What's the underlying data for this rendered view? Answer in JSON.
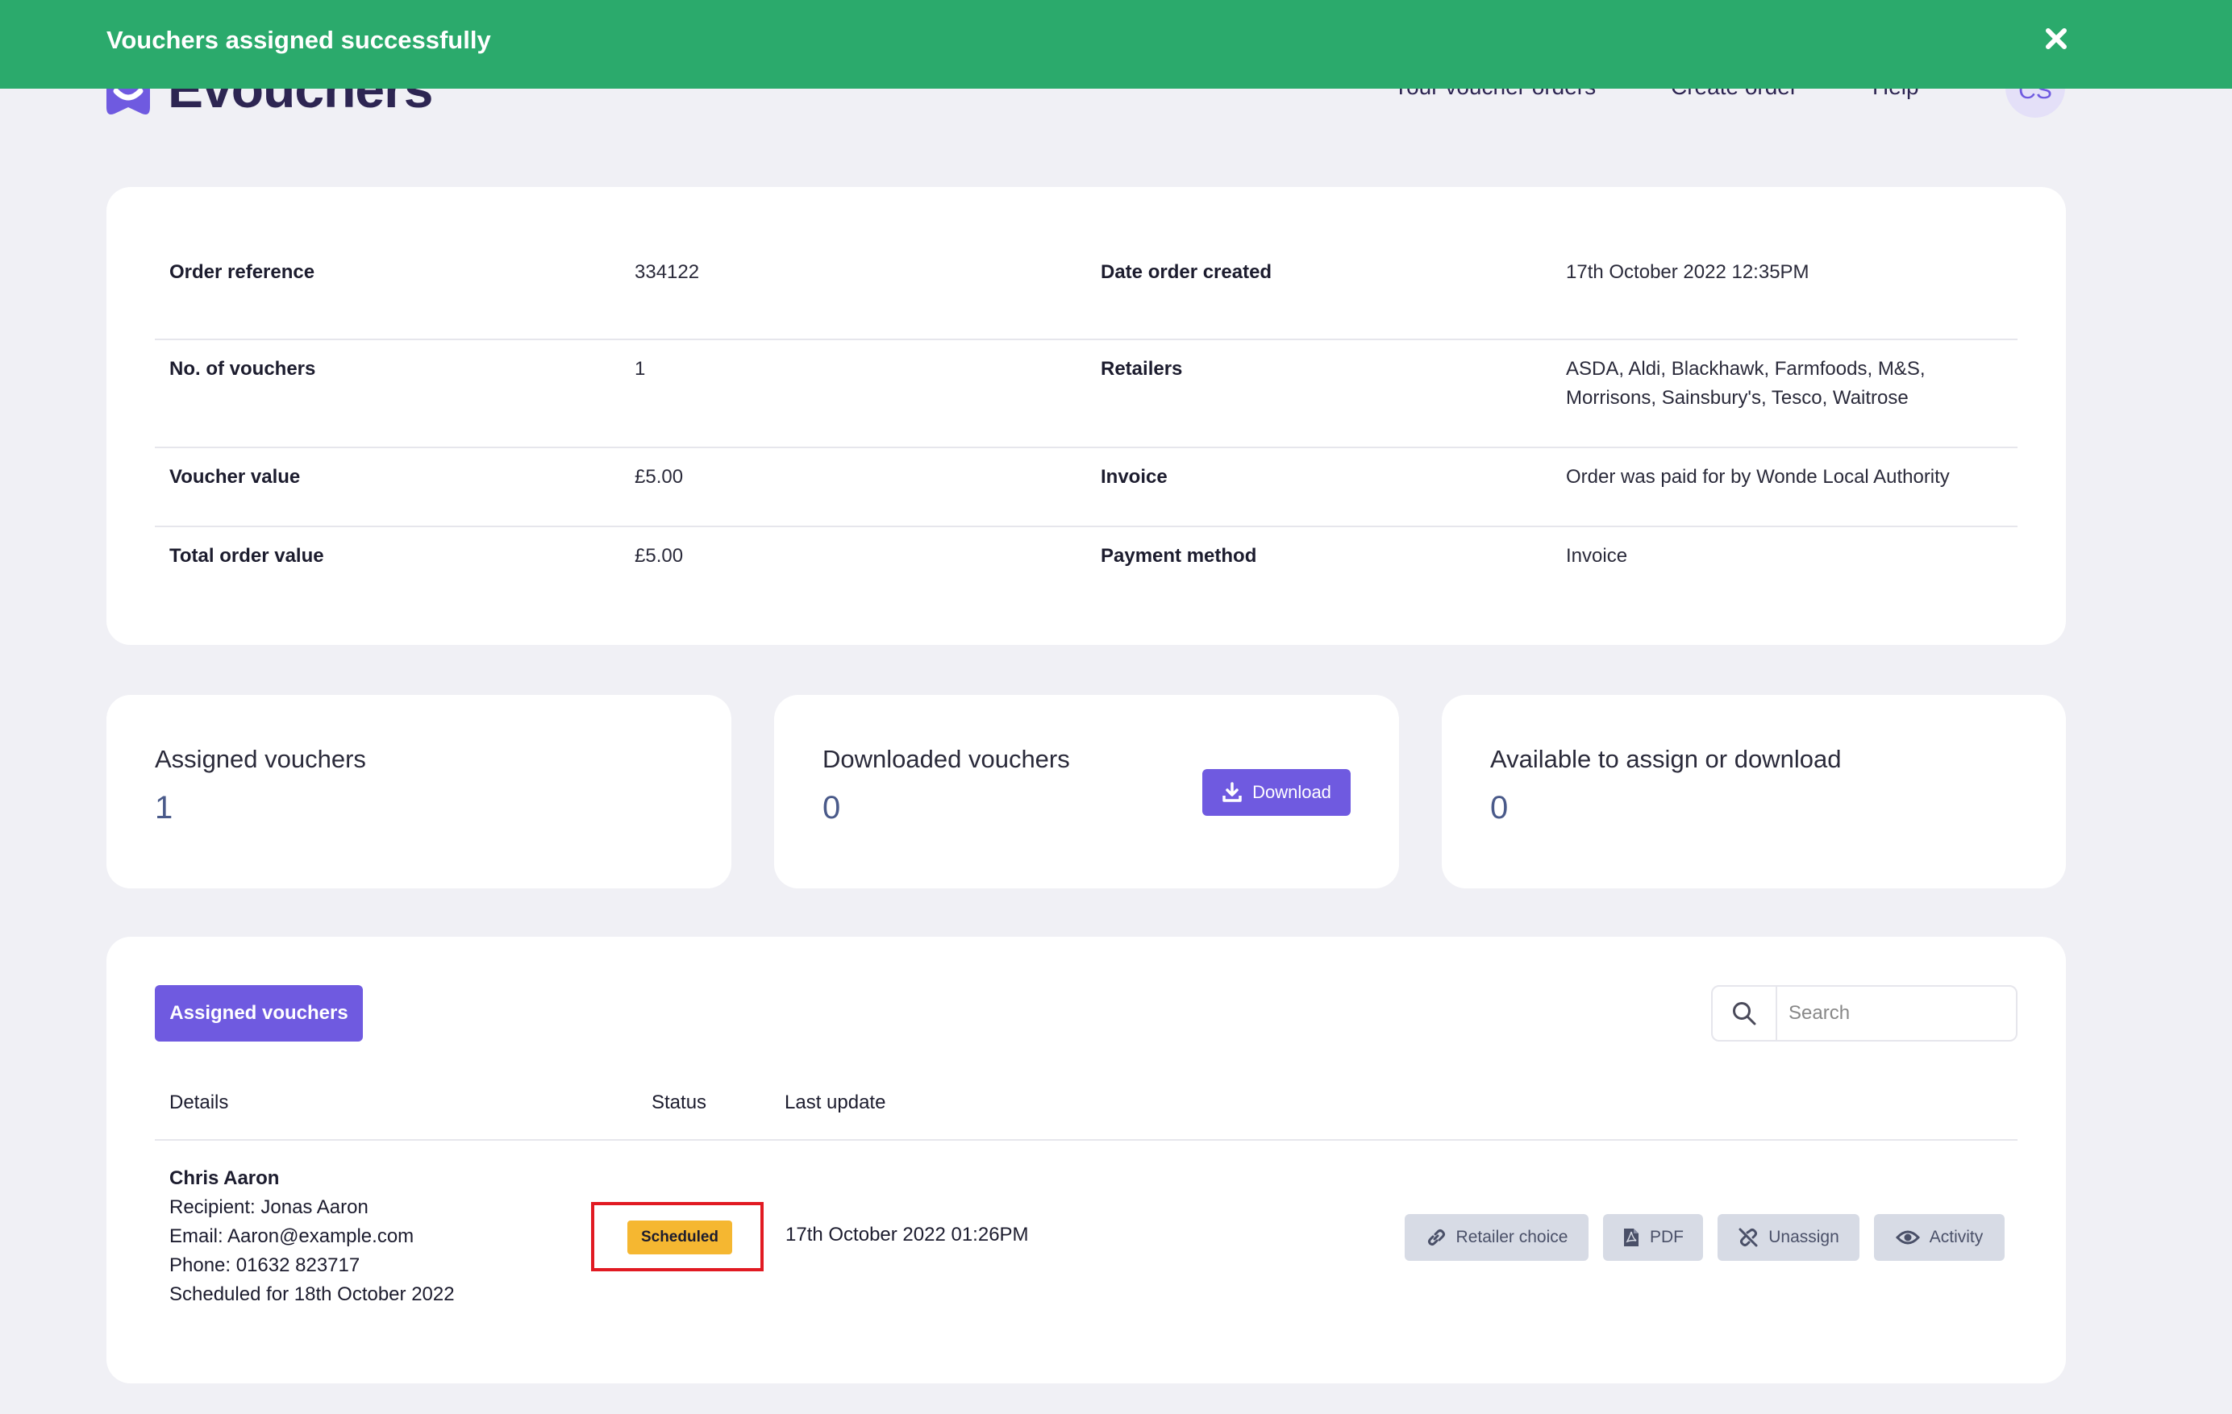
{
  "header": {
    "logo_text": "Evouchers",
    "nav": [
      "Your voucher orders",
      "Create order",
      "Help"
    ],
    "avatar_initials": "CS"
  },
  "toast": {
    "message": "Vouchers assigned successfully",
    "color": "#2baa6c",
    "close_icon": "close-icon"
  },
  "order_details": {
    "rows": [
      {
        "label1": "Order reference",
        "value1": "334122",
        "label2": "Date order created",
        "value2": "17th October 2022 12:35PM"
      },
      {
        "label1": "No. of vouchers",
        "value1": "1",
        "label2": "Retailers",
        "value2": "ASDA, Aldi, Blackhawk, Farmfoods, M&S,",
        "value2_line2": "Morrisons, Sainsbury's, Tesco, Waitrose"
      },
      {
        "label1": "Voucher value",
        "value1": "£5.00",
        "label2": "Invoice",
        "value2": "Order was paid for by Wonde Local Authority"
      },
      {
        "label1": "Total order value",
        "value1": "£5.00",
        "label2": "Payment method",
        "value2": "Invoice"
      }
    ]
  },
  "stats": [
    {
      "title": "Assigned vouchers",
      "value": "1"
    },
    {
      "title": "Downloaded vouchers",
      "value": "0",
      "button": "Download",
      "icon": "download-icon"
    },
    {
      "title": "Available to assign or download",
      "value": "0"
    }
  ],
  "vouchers": {
    "tab_label": "Assigned vouchers",
    "search_placeholder": "Search",
    "columns": [
      "Details",
      "Status",
      "Last update"
    ],
    "rows": [
      {
        "name": "Chris Aaron",
        "recipient": "Recipient: Jonas Aaron",
        "email": "Email: Aaron@example.com",
        "phone": "Phone: 01632 823717",
        "scheduled": "Scheduled for 18th October 2022",
        "status": "Scheduled",
        "last_update": "17th October 2022 01:26PM",
        "actions": [
          {
            "label": "Retailer choice",
            "icon": "link-icon"
          },
          {
            "label": "PDF",
            "icon": "pdf-file-icon"
          },
          {
            "label": "Unassign",
            "icon": "unlink-icon"
          },
          {
            "label": "Activity",
            "icon": "eye-icon"
          }
        ]
      }
    ]
  },
  "colors": {
    "accent": "#6f5ae0",
    "success": "#2baa6c",
    "status_scheduled": "#f5b731",
    "highlight": "#e11a22"
  }
}
